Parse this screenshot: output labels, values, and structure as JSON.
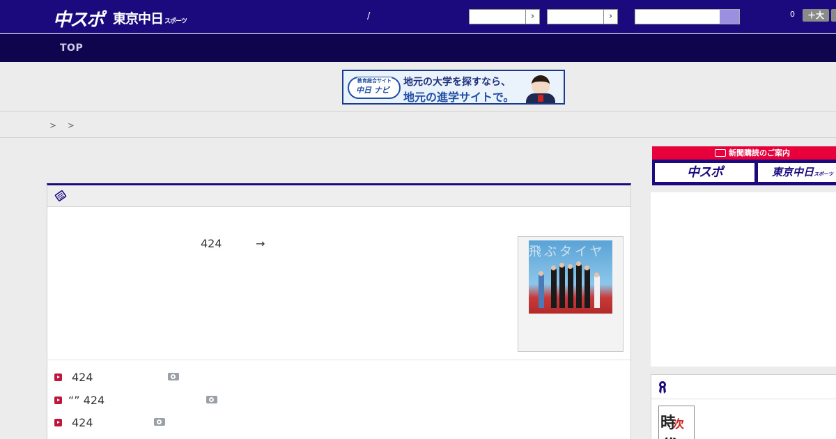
{
  "header": {
    "logo_primary": "中スポ",
    "logo_secondary": "東京中日",
    "logo_secondary_suffix": "スポーツ",
    "slash": "/",
    "select1_arrow": "›",
    "select2_arrow": "›",
    "zoom_value": "0",
    "zoom_label": "＋大"
  },
  "nav": {
    "top_label": "TOP"
  },
  "banner": {
    "logo_caption": "教育総合サイト",
    "logo_main": "中日 ナビ",
    "line1": "地元の大学を探すなら、",
    "line2": "地元の進学サイトで。"
  },
  "breadcrumb": {
    "text": "> >"
  },
  "article": {
    "number": "424",
    "arrow": "→",
    "thumb_text": "飛ぶタイヤ"
  },
  "related_list": [
    {
      "text": "424"
    },
    {
      "text": "“” 424"
    },
    {
      "text": "424"
    }
  ],
  "subscription": {
    "header": "新聞購読のご案内",
    "button1": "中スポ",
    "button2": "東京中日",
    "button2_suffix": "スポーツ"
  },
  "ranking": {
    "thumb_text_main": "時",
    "thumb_text_accent": "次",
    "thumb_text_end": "代"
  },
  "colors": {
    "header_bg": "#1a0a7e",
    "nav_bg": "#0f054f",
    "accent_red": "#e8003c",
    "bullet_red": "#c0163e"
  }
}
